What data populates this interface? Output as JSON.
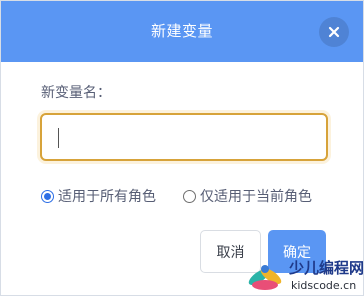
{
  "dialog": {
    "title": "新建变量",
    "close_icon": "close-icon",
    "name_label": "新变量名：",
    "input_value": "",
    "scope_options": [
      {
        "label": "适用于所有角色",
        "selected": true
      },
      {
        "label": "仅适用于当前角色",
        "selected": false
      }
    ],
    "cancel_label": "取消",
    "ok_label": "确定"
  },
  "watermark": {
    "title": "少儿编程网",
    "url": "kidscode.cn"
  },
  "colors": {
    "header": "#5a96f3",
    "input_border": "#d7a33a",
    "radio_selected": "#2d6fe6",
    "text": "#575e75"
  }
}
